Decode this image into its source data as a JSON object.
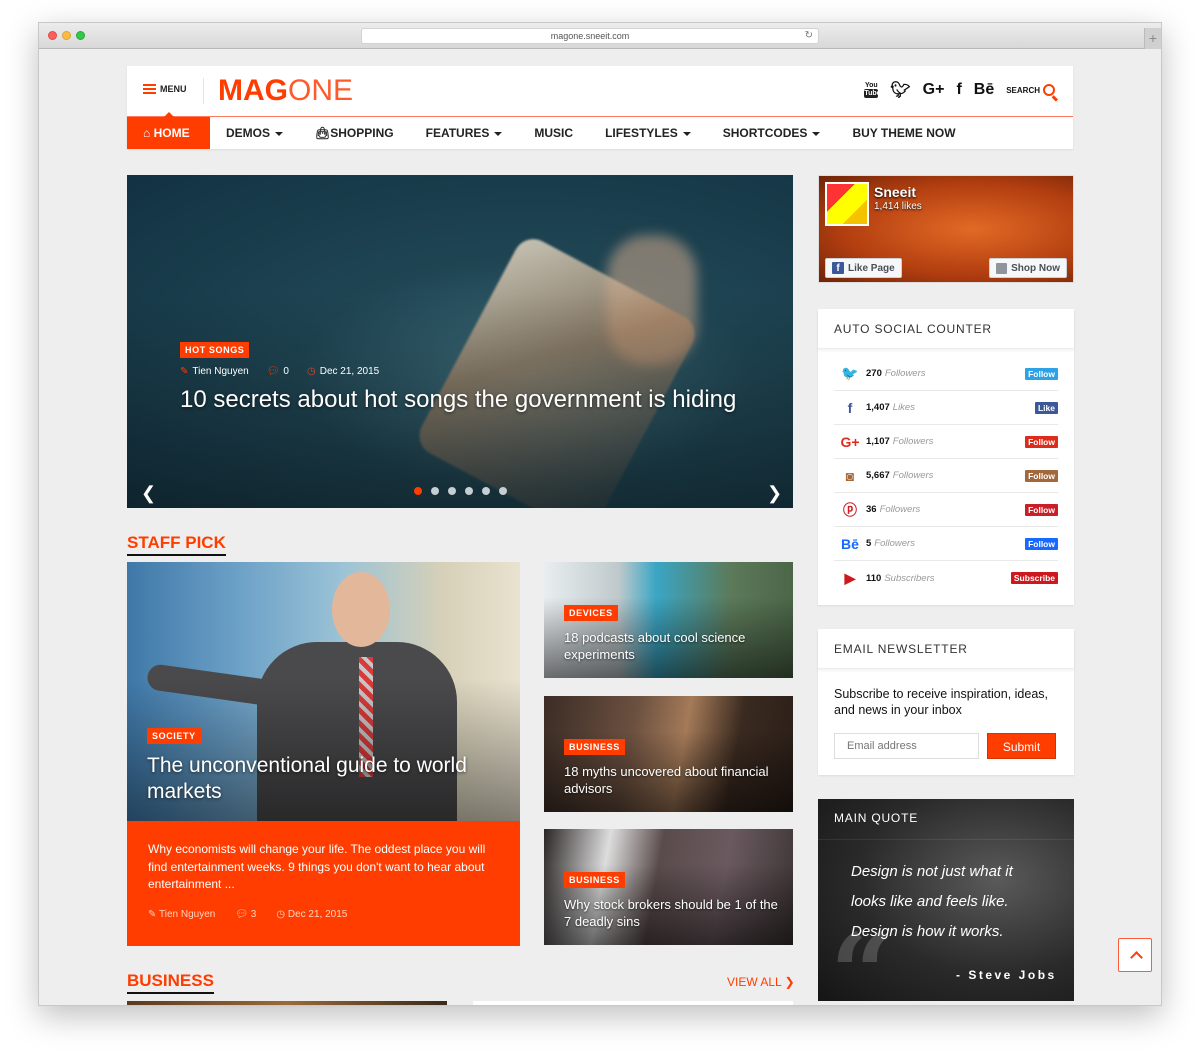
{
  "browser": {
    "url": "magone.sneeit.com"
  },
  "header": {
    "menu_label": "MENU",
    "logo_bold": "MAG",
    "logo_light": "ONE",
    "social_icons": [
      "youtube-icon",
      "twitter-icon",
      "google-plus-icon",
      "facebook-icon",
      "behance-icon"
    ],
    "search_label": "SEARCH"
  },
  "nav": {
    "items": [
      {
        "label": "HOME",
        "icon": "home-icon",
        "active": true
      },
      {
        "label": "DEMOS",
        "dropdown": true
      },
      {
        "label": "SHOPPING",
        "icon": "bag-icon"
      },
      {
        "label": "FEATURES",
        "dropdown": true
      },
      {
        "label": "MUSIC"
      },
      {
        "label": "LIFESTYLES",
        "dropdown": true
      },
      {
        "label": "SHORTCODES",
        "dropdown": true
      },
      {
        "label": "BUY THEME NOW"
      }
    ]
  },
  "slider": {
    "category": "HOT SONGS",
    "author": "Tien Nguyen",
    "comments": "0",
    "date": "Dec 21, 2015",
    "title": "10 secrets about hot songs the government is hiding",
    "slide_count": 6,
    "active_slide": 1
  },
  "staff_pick": {
    "heading": "STAFF PICK",
    "featured": {
      "category": "SOCIETY",
      "title": "The unconventional guide to world markets",
      "excerpt": "Why economists will change your life. The oddest place you will find entertainment weeks. 9 things you don't want to hear about entertainment ...",
      "author": "Tien Nguyen",
      "comments": "3",
      "date": "Dec 21, 2015"
    },
    "posts": [
      {
        "category": "DEVICES",
        "title": "18 podcasts about cool science experiments"
      },
      {
        "category": "BUSINESS",
        "title": "18 myths uncovered about financial advisors"
      },
      {
        "category": "BUSINESS",
        "title": "Why stock brokers should be 1 of the 7 deadly sins"
      }
    ]
  },
  "business": {
    "heading": "BUSINESS",
    "view_all": "VIEW ALL"
  },
  "facebook_box": {
    "page_name": "Sneeit",
    "likes": "1,414 likes",
    "like_button": "Like Page",
    "shop_button": "Shop Now"
  },
  "social_counter": {
    "heading": "AUTO SOCIAL COUNTER",
    "rows": [
      {
        "network": "twitter",
        "icon_glyph": "🐦",
        "color": "#2ea2e6",
        "count": "270",
        "unit": "Followers",
        "button": "Follow"
      },
      {
        "network": "facebook",
        "icon_glyph": "f",
        "color": "#3b5998",
        "count": "1,407",
        "unit": "Likes",
        "button": "Like"
      },
      {
        "network": "google-plus",
        "icon_glyph": "G+",
        "color": "#dd2c1c",
        "count": "1,107",
        "unit": "Followers",
        "button": "Follow"
      },
      {
        "network": "instagram",
        "icon_glyph": "◙",
        "color": "#a2673a",
        "count": "5,667",
        "unit": "Followers",
        "button": "Follow"
      },
      {
        "network": "pinterest",
        "icon_glyph": "ⓟ",
        "color": "#cb1f27",
        "count": "36",
        "unit": "Followers",
        "button": "Follow"
      },
      {
        "network": "behance",
        "icon_glyph": "Bē",
        "color": "#1769ff",
        "count": "5",
        "unit": "Followers",
        "button": "Follow"
      },
      {
        "network": "youtube",
        "icon_glyph": "▶",
        "color": "#cc181e",
        "count": "110",
        "unit": "Subscribers",
        "button": "Subscribe"
      }
    ]
  },
  "newsletter": {
    "heading": "EMAIL NEWSLETTER",
    "text": "Subscribe to receive inspiration, ideas, and news in your inbox",
    "placeholder": "Email address",
    "button": "Submit"
  },
  "main_quote": {
    "heading": "MAIN QUOTE",
    "text": "Design is not just what it looks like and feels like. Design is how it works.",
    "author": "- Steve Jobs"
  },
  "colors": {
    "accent": "#ff3d00",
    "page_bg": "#eeeeee"
  }
}
